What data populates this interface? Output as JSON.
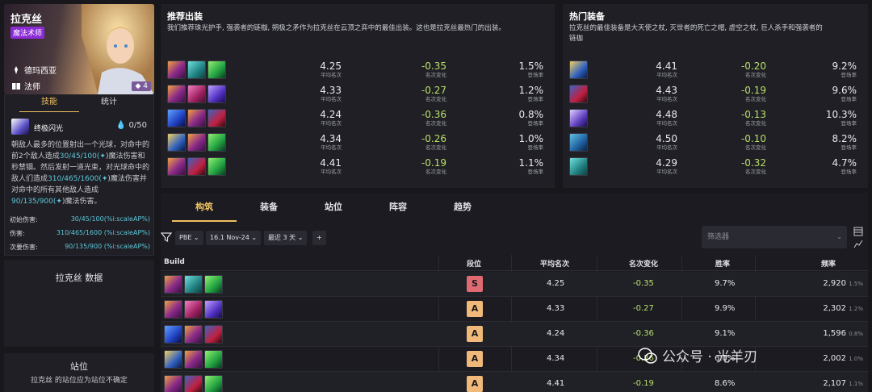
{
  "colors": {
    "accent": "#f0c060",
    "green": "#b7e06a",
    "cyan": "#5ec7d8",
    "tier_s": "#e06a72",
    "tier_a": "#f0b97a"
  },
  "champion": {
    "name": "拉克丝",
    "role": "魔法术师",
    "traits": [
      "德玛西亚",
      "法师"
    ],
    "cost": "4"
  },
  "skill_panel": {
    "tabs": [
      "技能",
      "统计"
    ],
    "skill_name": "终极闪光",
    "mana": "0/50",
    "desc_1": "朝敌人最多的位置射出一个光球，对命中的前2个敌人造成",
    "desc_v1": "30/45/100(",
    "desc_2": ")魔法伤害和秒禁锢。然后发射一道光束，对光球命中的敌人们造成",
    "desc_v2": "310/465/1600(",
    "desc_3": ")魔法伤害并对命中的所有其他敌人造成",
    "desc_v3": "90/135/900(",
    "desc_4": ")魔法伤害。",
    "stats": [
      {
        "label": "初始伤害:",
        "value": "30/45/100(%i:scaleAP%)"
      },
      {
        "label": "伤害:",
        "value": "310/465/1600  (%i:scaleAP%)"
      },
      {
        "label": "次要伤害:",
        "value": "90/135/900 (%i:scaleAP%)"
      }
    ]
  },
  "data_box": {
    "title": "拉克丝 数据"
  },
  "position_box": {
    "title": "站位",
    "desc": "拉克丝 的站位应为站位不确定"
  },
  "recommended": {
    "title": "推荐出装",
    "desc": "我们推荐珠光护手, 强袭者的链枷, 朔极之矛作为拉克丝在云顶之弈中的最佳出装。这也是拉克丝最热门的出装。",
    "metric_labels": [
      "平均名次",
      "名次变化",
      "登场率"
    ],
    "rows": [
      {
        "items": [
          "gauntlet-icon",
          "flail-icon",
          "spear-icon"
        ],
        "avg": "4.25",
        "change": "-0.35",
        "rate": "1.5%"
      },
      {
        "items": [
          "gauntlet-icon",
          "wand-icon",
          "staff-icon"
        ],
        "avg": "4.33",
        "change": "-0.27",
        "rate": "1.2%"
      },
      {
        "items": [
          "orb-icon",
          "gauntlet-icon",
          "blade-icon"
        ],
        "avg": "4.24",
        "change": "-0.36",
        "rate": "0.8%"
      },
      {
        "items": [
          "hat-icon",
          "gauntlet-icon",
          "spear-icon"
        ],
        "avg": "4.34",
        "change": "-0.26",
        "rate": "1.0%"
      },
      {
        "items": [
          "gauntlet-icon",
          "blade-icon",
          "spear-icon"
        ],
        "avg": "4.41",
        "change": "-0.19",
        "rate": "1.1%"
      }
    ]
  },
  "hot_items": {
    "title": "热门装备",
    "desc_line1": "拉克丝的最佳装备是大天使之杖, 灭世者的死亡之帽, 虚空之杖, 巨人杀手和强袭者的",
    "desc_line2": "链枷",
    "metric_labels": [
      "平均名次",
      "名次变化",
      "登场率"
    ],
    "rows": [
      {
        "item": "archangel-staff-icon",
        "avg": "4.41",
        "change": "-0.20",
        "rate": "9.2%"
      },
      {
        "item": "rabadon-cap-icon",
        "avg": "4.43",
        "change": "-0.19",
        "rate": "9.6%"
      },
      {
        "item": "void-staff-icon",
        "avg": "4.48",
        "change": "-0.13",
        "rate": "10.3%"
      },
      {
        "item": "giant-slayer-icon",
        "avg": "4.50",
        "change": "-0.10",
        "rate": "8.2%"
      },
      {
        "item": "flail-icon",
        "avg": "4.29",
        "change": "-0.32",
        "rate": "4.7%"
      }
    ]
  },
  "build": {
    "tabs": [
      "构筑",
      "装备",
      "站位",
      "阵容",
      "趋势"
    ],
    "filters": {
      "server": "PBE",
      "patch": "16.1 Nov-24",
      "range": "最近 3 天",
      "add": "+",
      "search_placeholder": "筛选器"
    },
    "headers": [
      "Build",
      "段位",
      "平均名次",
      "名次变化",
      "胜率",
      "频率"
    ],
    "rows": [
      {
        "tier": "S",
        "avg": "4.25",
        "change": "-0.35",
        "win": "9.7%",
        "freq": "2,920",
        "freq_pct": "1.5%"
      },
      {
        "tier": "A",
        "avg": "4.33",
        "change": "-0.27",
        "win": "9.9%",
        "freq": "2,302",
        "freq_pct": "1.2%"
      },
      {
        "tier": "A",
        "avg": "4.24",
        "change": "-0.36",
        "win": "9.1%",
        "freq": "1,596",
        "freq_pct": "0.8%"
      },
      {
        "tier": "A",
        "avg": "4.34",
        "change": "-0.26",
        "win": "6.0%",
        "freq": "2,002",
        "freq_pct": "1.0%"
      },
      {
        "tier": "A",
        "avg": "4.41",
        "change": "-0.19",
        "win": "8.6%",
        "freq": "2,107",
        "freq_pct": "1.1%"
      }
    ]
  },
  "watermark": {
    "text": "公众号 · 光羊刃"
  }
}
